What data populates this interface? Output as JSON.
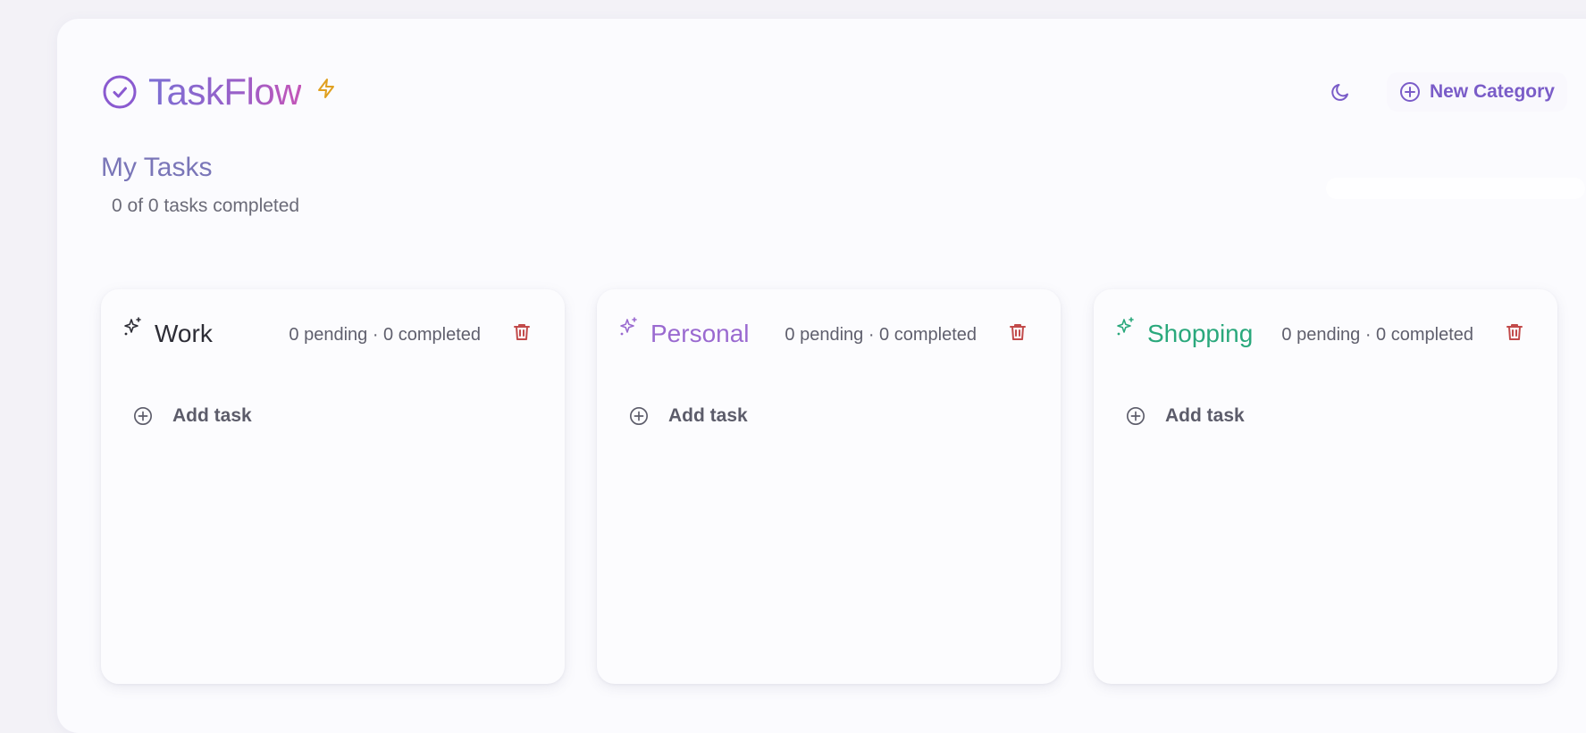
{
  "app": {
    "title": "TaskFlow"
  },
  "header": {
    "new_category_label": "New Category"
  },
  "page": {
    "title": "My Tasks",
    "subtitle": "0 of 0 tasks completed"
  },
  "colors": {
    "accent": "#7a5cc8",
    "danger": "#c24a4a",
    "bolt": "#e0a020",
    "work": "#2d2d36",
    "personal": "#9a6ad0",
    "shopping": "#2aa87c"
  },
  "icons": {
    "logo": "check-circle-icon",
    "bolt": "bolt-icon",
    "theme": "moon-icon",
    "add": "plus-circle-icon",
    "category": "sparkles-icon",
    "delete": "trash-icon"
  },
  "categories": [
    {
      "name": "Work",
      "stats": "0 pending · 0 completed",
      "add_label": "Add task"
    },
    {
      "name": "Personal",
      "stats": "0 pending · 0 completed",
      "add_label": "Add task"
    },
    {
      "name": "Shopping",
      "stats": "0 pending · 0 completed",
      "add_label": "Add task"
    }
  ]
}
